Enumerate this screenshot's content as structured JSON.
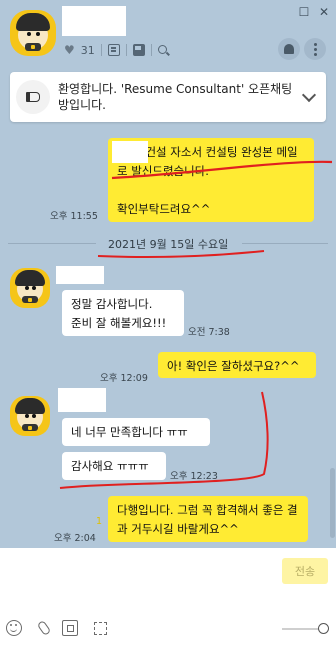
{
  "header": {
    "member_count": "31",
    "window_controls": [
      "☐",
      "✕"
    ]
  },
  "notice": {
    "text": "환영합니다. 'Resume Consultant' 오픈채팅방입니다."
  },
  "messages": [
    {
      "side": "right",
      "text": "             , 현대건설 자소서 컨설팅 완성본 메일로 발신드렸습니다.\n\n확인부탁드려요^^",
      "time": "오후 11:55"
    },
    {
      "type": "date",
      "text": "2021년 9월 15일 수요일"
    },
    {
      "side": "left",
      "text": "정말 감사합니다.\n준비 잘 해볼게요!!!",
      "time": "오전 7:38"
    },
    {
      "side": "right",
      "text": "아! 확인은 잘하셨구요?^^",
      "time": "오후 12:09"
    },
    {
      "side": "left",
      "text": "네 너무 만족합니다 ㅠㅠ",
      "time": ""
    },
    {
      "side": "left",
      "text": "감사해요 ㅠㅠㅠ",
      "time": "오후 12:23"
    },
    {
      "side": "right",
      "text": "다행입니다. 그럼 꼭 합격해서 좋은 결과 거두시길 바랄게요^^",
      "time": "오후 2:04",
      "unread": "1"
    }
  ],
  "composer": {
    "send_label": "전송"
  },
  "colors": {
    "chat_bg": "#b2c7d9",
    "my_bubble": "#ffeb33",
    "their_bubble": "#ffffff",
    "highlight_ink": "#e02020"
  }
}
